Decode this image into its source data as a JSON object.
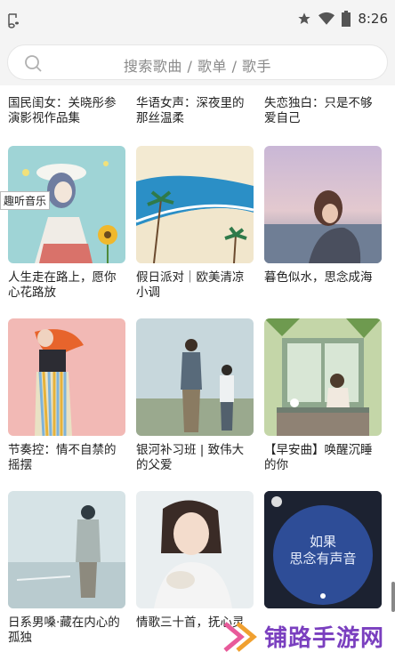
{
  "status": {
    "time": "8:26"
  },
  "search": {
    "placeholder": "搜索歌曲 / 歌单 / 歌手"
  },
  "cards_row0": [
    {
      "title": "国民闺女：关晓彤参演影视作品集"
    },
    {
      "title": "华语女声：深夜里的那丝温柔"
    },
    {
      "title": "失恋独白：只是不够爱自己"
    }
  ],
  "cards": [
    {
      "title": "人生走在路上，愿你心花路放",
      "cover": "girl-illustration"
    },
    {
      "title": "假日派对｜欧美清凉小调",
      "cover": "beach-illustration"
    },
    {
      "title": "暮色似水，思念成海",
      "cover": "twilight-sea-photo"
    },
    {
      "title": "节奏控：情不自禁的摇摆",
      "cover": "dancing-woman-illustration"
    },
    {
      "title": "银河补习班 | 致伟大的父爱",
      "cover": "father-son-photo"
    },
    {
      "title": "【早安曲】唤醒沉睡的你",
      "cover": "window-girl-illustration"
    },
    {
      "title": "日系男嗓·藏在内心的孤独",
      "cover": "seaside-boy-photo"
    },
    {
      "title": "情歌三十首，抚心灵",
      "cover": "smiling-girl-photo"
    },
    {
      "title": "",
      "cover": "dark-blue-poster",
      "cover_text_line1": "如果",
      "cover_text_line2": "思念有声音"
    }
  ],
  "overlay_tag": "趣听音乐",
  "watermark": "铺路手游网",
  "colors": {
    "accent_purple": "#7a3fbf",
    "background": "#ffffff",
    "status_bar": "#f4f4f4"
  }
}
